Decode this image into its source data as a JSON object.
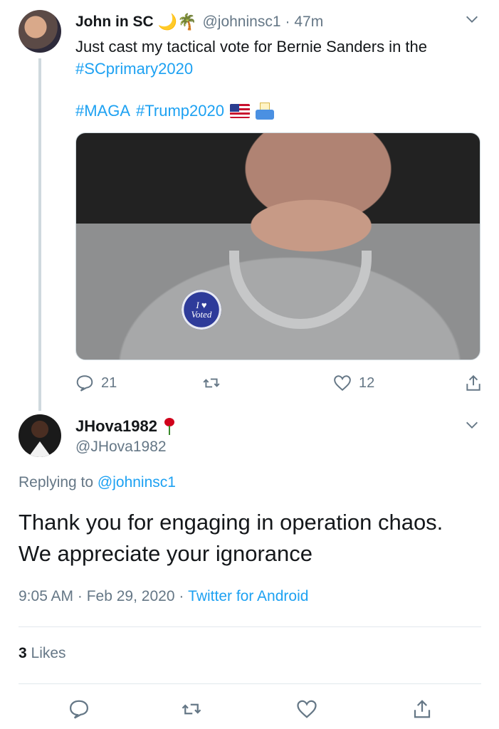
{
  "parent_tweet": {
    "display_name": "John in SC",
    "name_emoji": "🌙🌴",
    "handle": "@johninsc1",
    "time": "· 47m",
    "text": "Just cast my tactical vote for Bernie Sanders in the",
    "hashtag_line1": "#SCprimary2020",
    "hashtags": [
      "#MAGA",
      "#Trump2020"
    ],
    "tag_emojis": [
      "us-flag-icon",
      "ballot-box-icon"
    ],
    "sticker_text_line1": "I ♥",
    "sticker_text_line2": "Voted",
    "replies": "21",
    "retweets": "",
    "likes": "12"
  },
  "reply_tweet": {
    "display_name": "JHova1982",
    "name_emoji": "rose-icon",
    "handle": "@JHova1982",
    "replying_prefix": "Replying to",
    "replying_to": "@johninsc1",
    "text": "Thank you for engaging in operation chaos. We appreciate your ignorance",
    "time": "9:05 AM",
    "date": "Feb 29, 2020",
    "source": "Twitter for Android",
    "likes_count": "3",
    "likes_label": "Likes"
  },
  "colors": {
    "link": "#1da1f2",
    "secondary_text": "#657786",
    "primary_text": "#14171a",
    "divider": "#e1e8ed"
  }
}
